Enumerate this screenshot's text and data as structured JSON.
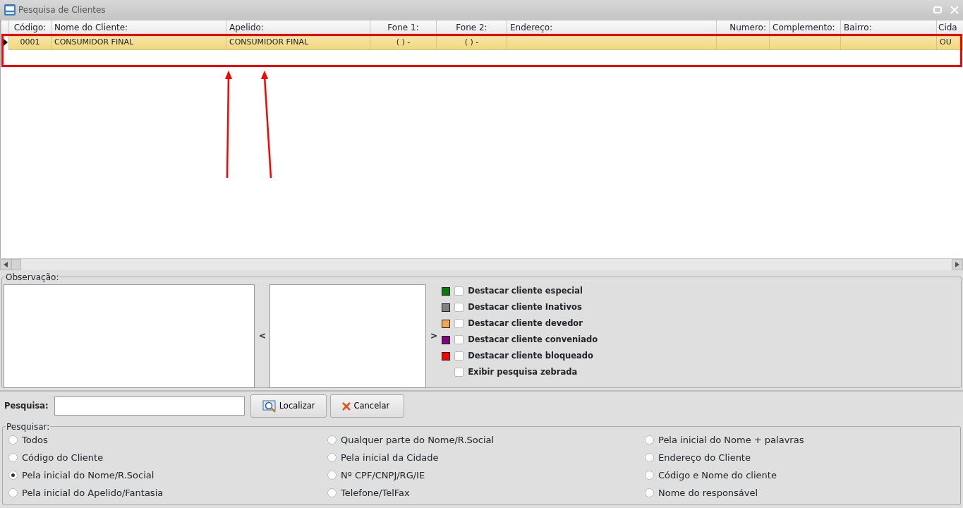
{
  "window": {
    "title": "Pesquisa de Clientes"
  },
  "table": {
    "columns": [
      {
        "label": "Código:"
      },
      {
        "label": "Nome do Cliente:"
      },
      {
        "label": "Apelido:"
      },
      {
        "label": "Fone 1:"
      },
      {
        "label": "Fone 2:"
      },
      {
        "label": "Endereço:"
      },
      {
        "label": "Numero:"
      },
      {
        "label": "Complemento:"
      },
      {
        "label": "Bairro:"
      },
      {
        "label": "Cida"
      }
    ],
    "rows": [
      {
        "selected": true,
        "cells": [
          "0001",
          "CONSUMIDOR FINAL",
          "CONSUMIDOR FINAL",
          "(  )     -",
          "(  )     -",
          "",
          "",
          "",
          "",
          "OU"
        ]
      }
    ]
  },
  "observacao": {
    "label": "Observação:",
    "left_arrow": "<",
    "right_arrow": ">"
  },
  "highlights": [
    {
      "label": "Destacar cliente especial",
      "color": "#0a7a0a",
      "checked": false
    },
    {
      "label": "Destacar cliente Inativos",
      "color": "#808080",
      "checked": false
    },
    {
      "label": "Destacar cliente devedor",
      "color": "#f0a850",
      "checked": false
    },
    {
      "label": "Destacar cliente conveniado",
      "color": "#800080",
      "checked": false
    },
    {
      "label": "Destacar cliente bloqueado",
      "color": "#ff0000",
      "checked": false
    },
    {
      "label": "Exibir pesquisa zebrada",
      "checked": false
    }
  ],
  "search": {
    "label": "Pesquisa:",
    "find_button": "Localizar",
    "cancel_button": "Cancelar"
  },
  "search_by": {
    "label": "Pesquisar:",
    "options": [
      {
        "label": "Todos",
        "selected": false
      },
      {
        "label": "Qualquer parte do Nome/R.Social",
        "selected": false
      },
      {
        "label": "Pela inicial do Nome + palavras",
        "selected": false
      },
      {
        "label": "Código do Cliente",
        "selected": false
      },
      {
        "label": "Pela inicial da Cidade",
        "selected": false
      },
      {
        "label": "Endereço do Cliente",
        "selected": false
      },
      {
        "label": "Pela inicial do Nome/R.Social",
        "selected": true
      },
      {
        "label": "Nº CPF/CNPJ/RG/IE",
        "selected": false
      },
      {
        "label": "Código e Nome do cliente",
        "selected": false
      },
      {
        "label": "Pela inicial do Apelido/Fantasia",
        "selected": false
      },
      {
        "label": "Telefone/TelFax",
        "selected": false
      },
      {
        "label": "Nome do responsável",
        "selected": false
      }
    ]
  },
  "annotations": [
    {
      "kind": "frame"
    },
    {
      "kind": "arrow"
    },
    {
      "kind": "arrow"
    }
  ]
}
